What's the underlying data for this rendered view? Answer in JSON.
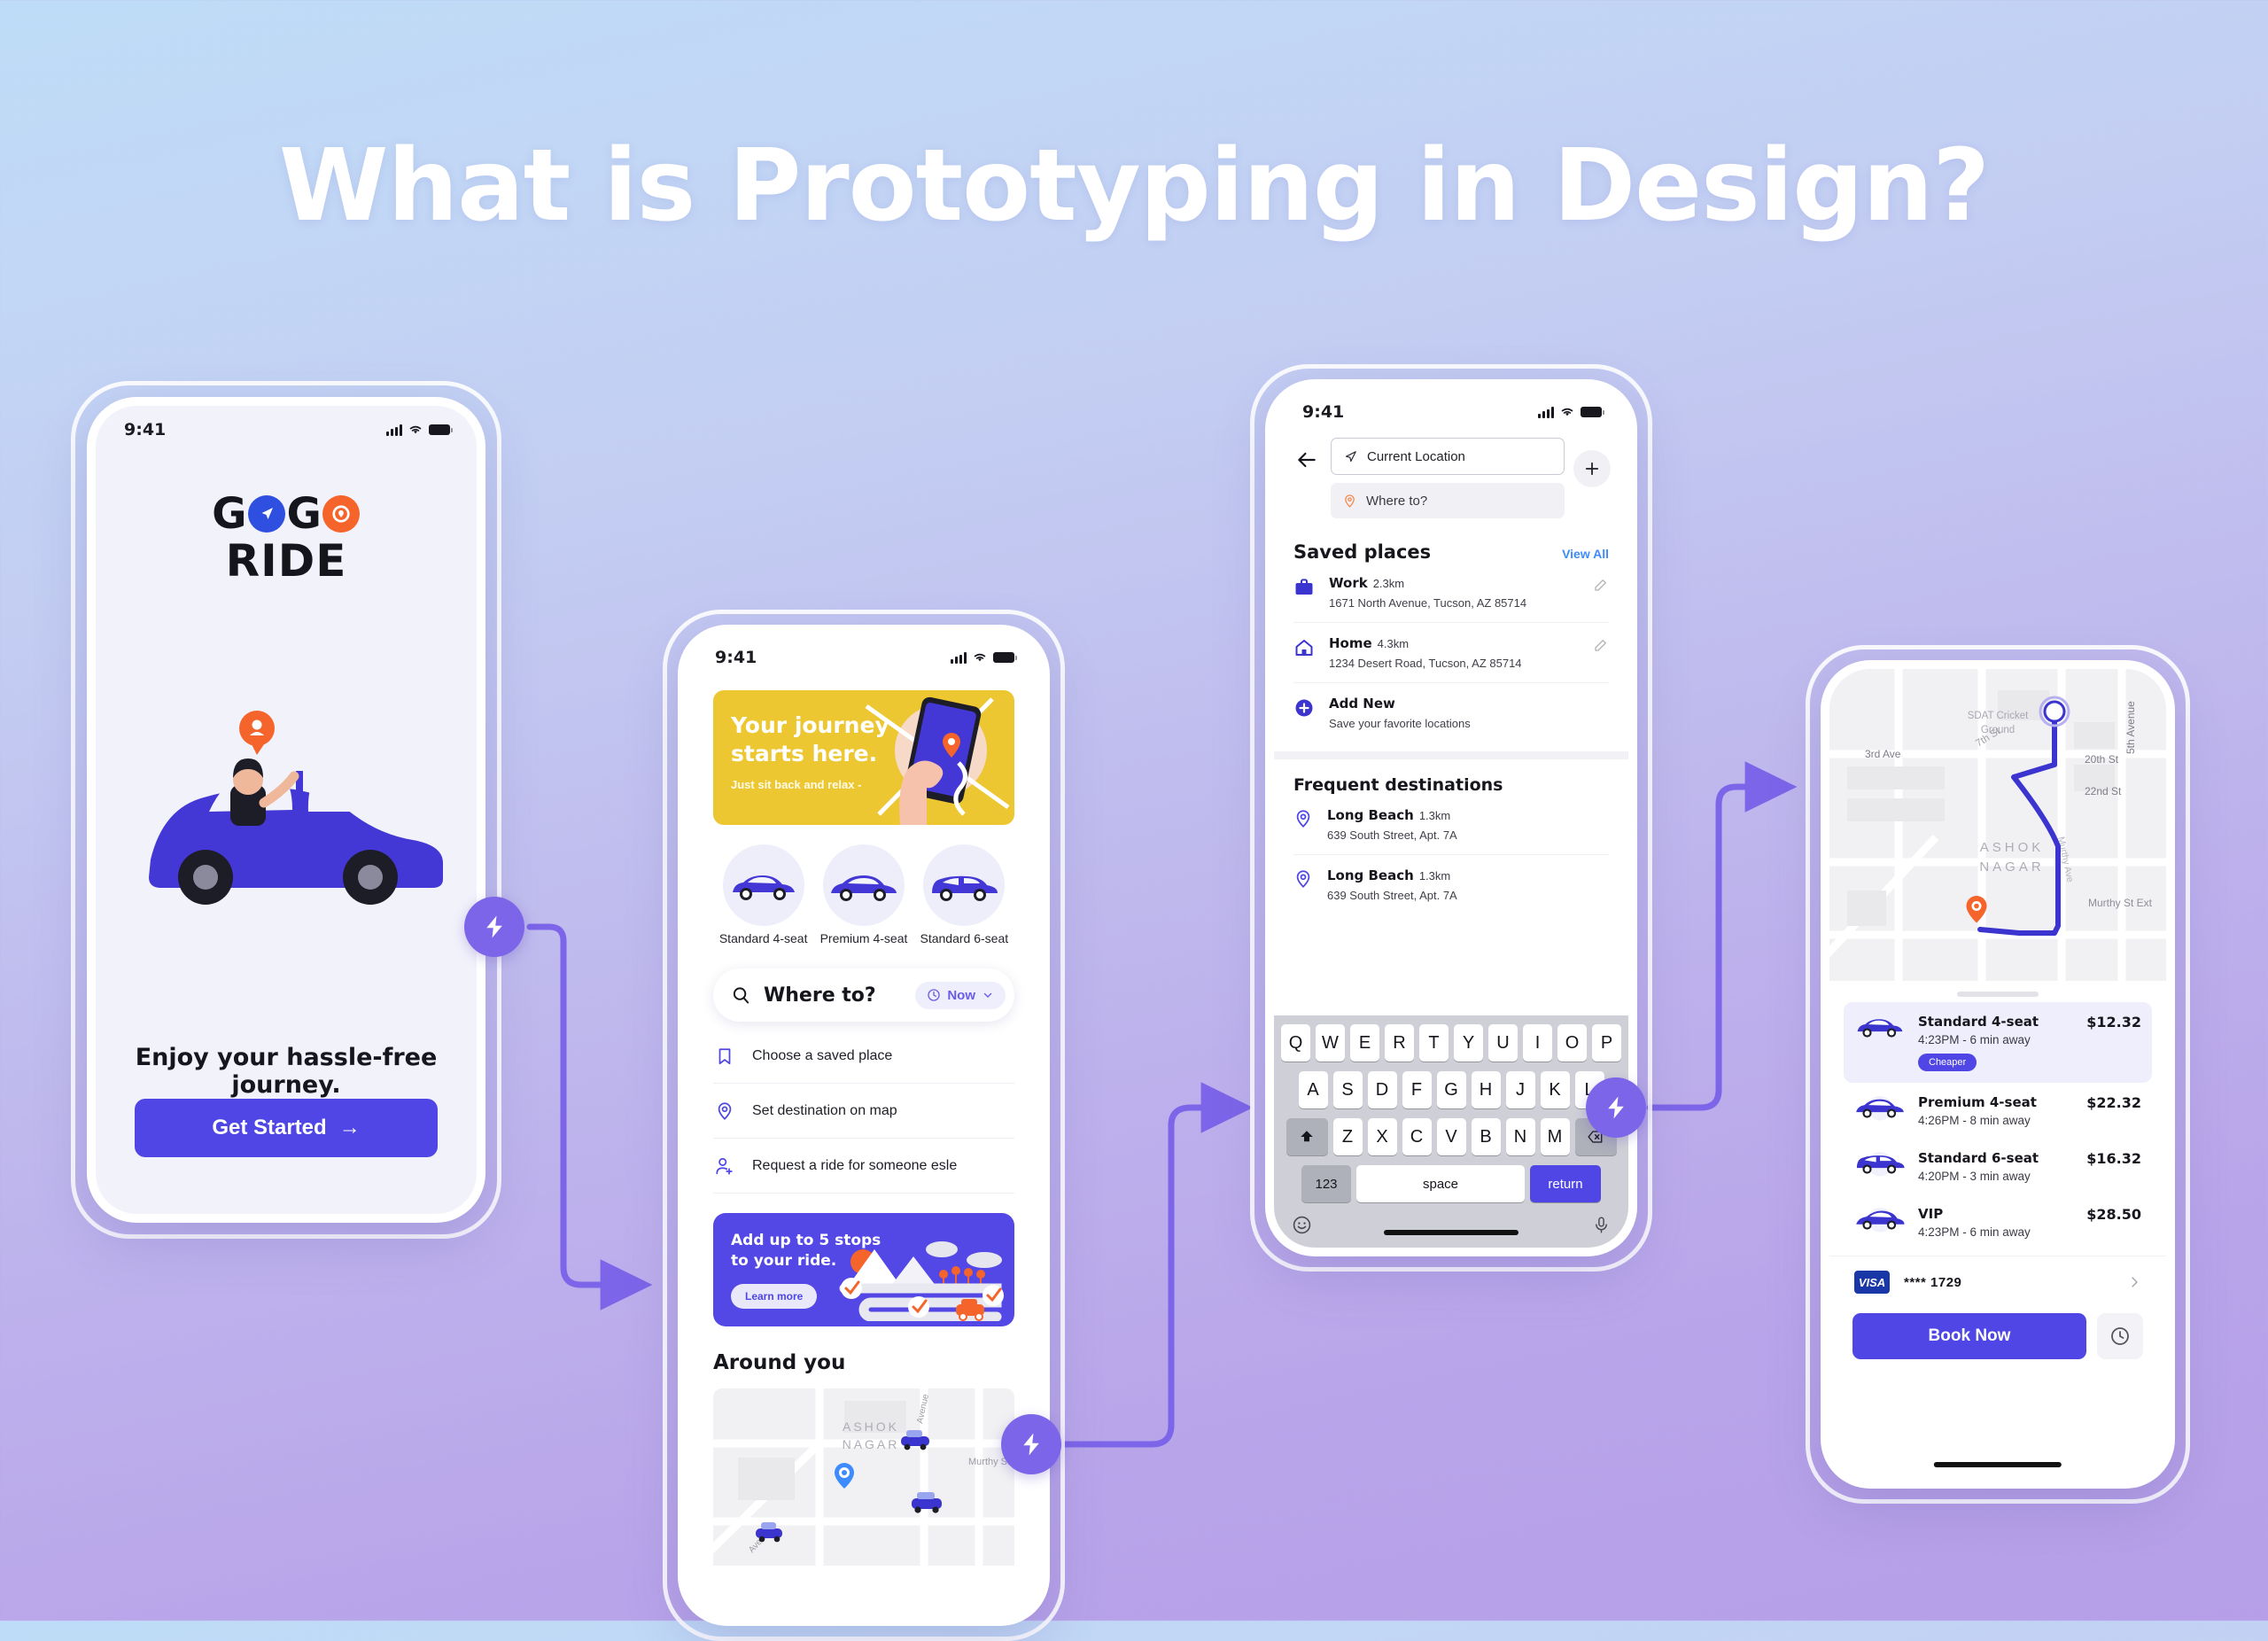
{
  "page": {
    "title": "What is Prototyping in Design?",
    "accent_purple": "#4f46e5",
    "bolt_purple": "#7c65e8",
    "bg_top": "#bedcf7",
    "bg_bottom": "#b69fe8"
  },
  "status_bar": {
    "time": "9:41"
  },
  "phone1": {
    "logo": {
      "line1_left": "G",
      "line1_mid": "G",
      "line2": "RIDE"
    },
    "tagline": "Enjoy your hassle-free journey.",
    "cta": "Get Started",
    "cta_arrow": "→"
  },
  "phone2": {
    "banner": {
      "title_line1": "Your journey",
      "title_line2": "starts here.",
      "subtitle": "Just sit back and relax -"
    },
    "car_options": [
      {
        "label": "Standard 4-seat"
      },
      {
        "label": "Premium 4-seat"
      },
      {
        "label": "Standard 6-seat"
      }
    ],
    "search": {
      "placeholder": "Where to?",
      "time_chip": "Now"
    },
    "menu": [
      {
        "label": "Choose a saved place",
        "icon": "bookmark-icon"
      },
      {
        "label": "Set destination on map",
        "icon": "pin-icon"
      },
      {
        "label": "Request a ride for someone esle",
        "icon": "person-add-icon"
      }
    ],
    "promo": {
      "title_line1": "Add up to 5 stops",
      "title_line2": "to your ride.",
      "button": "Learn more"
    },
    "around_title": "Around you",
    "map_labels": {
      "area": "ASHOK NAGAR",
      "street1": "Murthy St Ext",
      "street2": "Avenue"
    }
  },
  "phone3": {
    "origin": "Current Location",
    "destination_placeholder": "Where to?",
    "saved_title": "Saved places",
    "view_all": "View All",
    "saved_places": [
      {
        "name": "Work",
        "distance": "2.3km",
        "address": "1671 North Avenue, Tucson, AZ 85714",
        "icon": "briefcase-icon"
      },
      {
        "name": "Home",
        "distance": "4.3km",
        "address": "1234 Desert Road, Tucson, AZ 85714",
        "icon": "house-icon"
      },
      {
        "name": "Add New",
        "distance": "",
        "address": "Save your favorite locations",
        "icon": "plus-circle-icon"
      }
    ],
    "frequent_title": "Frequent destinations",
    "frequent": [
      {
        "name": "Long Beach",
        "distance": "1.3km",
        "address": "639 South Street, Apt. 7A"
      },
      {
        "name": "Long Beach",
        "distance": "1.3km",
        "address": "639 South Street, Apt. 7A"
      }
    ],
    "keyboard": {
      "row1": [
        "Q",
        "W",
        "E",
        "R",
        "T",
        "Y",
        "U",
        "I",
        "O",
        "P"
      ],
      "row2": [
        "A",
        "S",
        "D",
        "F",
        "G",
        "H",
        "J",
        "K",
        "L"
      ],
      "row3": [
        "Z",
        "X",
        "C",
        "V",
        "B",
        "N",
        "M"
      ],
      "shift": "⬆",
      "backspace": "⌫",
      "numbers": "123",
      "space": "space",
      "return": "return"
    }
  },
  "phone4": {
    "map_labels": {
      "poi": "SDAT Cricket Ground",
      "s1": "7th St",
      "s2": "3rd Ave",
      "s3": "20th St",
      "s4": "22nd St",
      "s5": "5th Avenue",
      "area": "ASHOK NAGAR",
      "s6": "Murthy St Ext"
    },
    "rides": [
      {
        "name": "Standard 4-seat",
        "eta": "4:23PM - 6 min away",
        "price": "$12.32",
        "badge": "Cheaper",
        "selected": true
      },
      {
        "name": "Premium 4-seat",
        "eta": "4:26PM - 8 min away",
        "price": "$22.32",
        "badge": "",
        "selected": false
      },
      {
        "name": "Standard 6-seat",
        "eta": "4:20PM - 3 min away",
        "price": "$16.32",
        "badge": "",
        "selected": false
      },
      {
        "name": "VIP",
        "eta": "4:23PM - 6 min away",
        "price": "$28.50",
        "badge": "",
        "selected": false
      }
    ],
    "payment": {
      "brand": "VISA",
      "number": "**** 1729"
    },
    "book_button": "Book Now"
  }
}
